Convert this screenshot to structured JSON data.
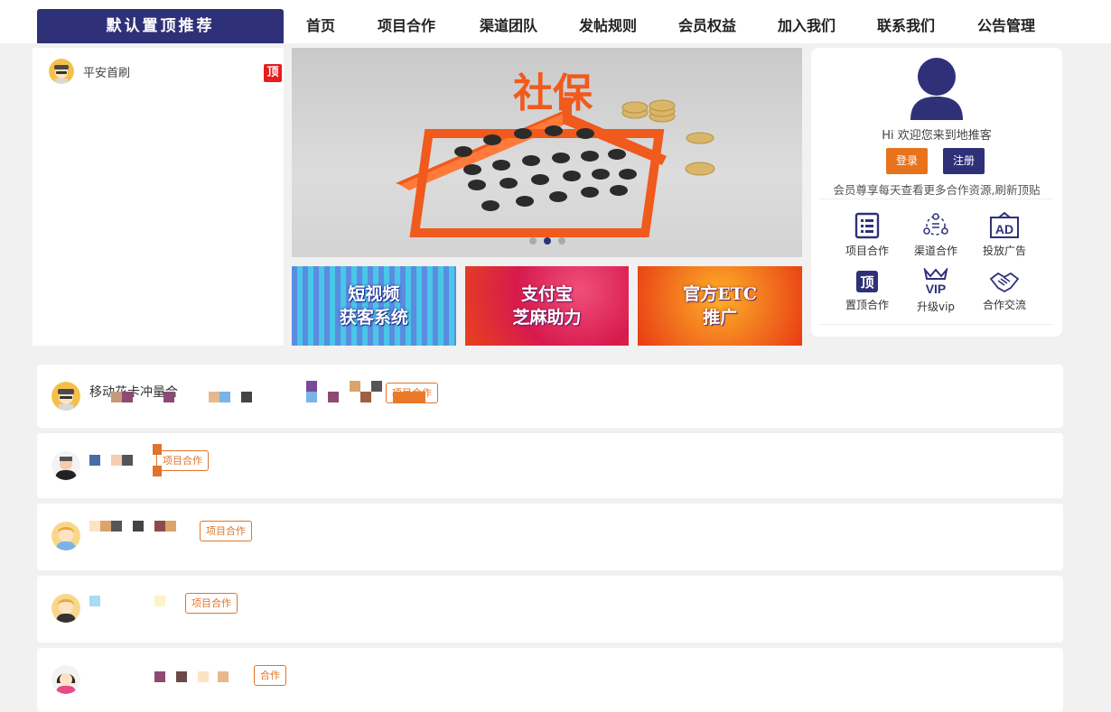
{
  "header": {
    "promo_tab": "默认置顶推荐",
    "nav": [
      "首页",
      "项目合作",
      "渠道团队",
      "发帖规则",
      "会员权益",
      "加入我们",
      "联系我们",
      "公告管理"
    ]
  },
  "pinned": {
    "name": "平安首刷",
    "badge": "顶"
  },
  "banner": {
    "headline": "社保",
    "dots": 3,
    "active_dot": 1
  },
  "tiles": [
    {
      "text": "短视频\n获客系统"
    },
    {
      "text": "支付宝\n芝麻助力"
    },
    {
      "text": "官方ETC\n推广"
    }
  ],
  "user": {
    "welcome": "Hi 欢迎您来到地推客",
    "login": "登录",
    "register": "注册",
    "tip": "会员尊享每天查看更多合作资源,刷新顶贴",
    "grid": [
      {
        "icon": "list-doc-icon",
        "label": "项目合作"
      },
      {
        "icon": "network-icon",
        "label": "渠道合作"
      },
      {
        "icon": "ad-icon",
        "label": "投放广告"
      },
      {
        "icon": "pin-top-icon",
        "label": "置顶合作"
      },
      {
        "icon": "vip-crown-icon",
        "label": "升级vip"
      },
      {
        "icon": "handshake-icon",
        "label": "合作交流"
      }
    ]
  },
  "feed": [
    {
      "title": "移动花卡冲量合",
      "tag": "项目合作"
    },
    {
      "title": "",
      "tag": "项目合作"
    },
    {
      "title": "",
      "tag": "项目合作"
    },
    {
      "title": "",
      "tag": "项目合作"
    },
    {
      "title": "",
      "tag": "合作"
    }
  ],
  "colors": {
    "brand": "#2f3178",
    "accent": "#e8731d",
    "badge": "#e51d1d"
  }
}
